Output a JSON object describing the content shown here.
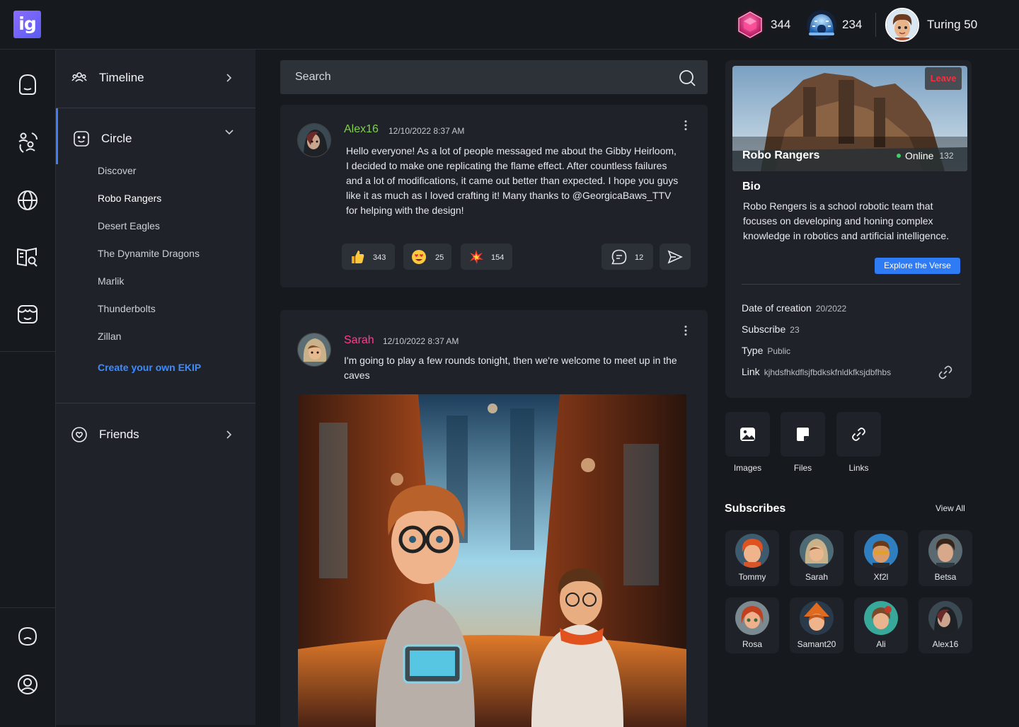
{
  "app": {
    "logo_text": "ig"
  },
  "topbar": {
    "stats": [
      {
        "icon": "pink-gem-icon",
        "value": "344"
      },
      {
        "icon": "blue-dome-icon",
        "value": "234"
      }
    ],
    "profile": {
      "name": "Turing 50",
      "avatar": "user-avatar"
    }
  },
  "rail": {
    "top_icons": [
      "home-icon",
      "people-icon",
      "globe-icon",
      "book-search-icon",
      "mask-icon"
    ],
    "bottom_icons": [
      "face-icon",
      "user-profile-icon"
    ]
  },
  "sidebar": {
    "timeline": {
      "label": "Timeline",
      "icon": "group-icon"
    },
    "circle": {
      "label": "Circle",
      "icon": "smiley-square-icon",
      "items": [
        "Discover",
        "Robo Rangers",
        "Desert Eagles",
        "The Dynamite Dragons",
        "Marlik",
        "Thunderbolts",
        "Zillan"
      ],
      "active_item": "Robo Rangers",
      "create_label": "Create your own EKIP"
    },
    "friends": {
      "label": "Friends",
      "icon": "heart-circle-icon"
    }
  },
  "search": {
    "placeholder": "Search"
  },
  "posts": [
    {
      "author": "Alex16",
      "author_color": "#7fd14a",
      "time": "12/10/2022 8:37 AM",
      "text": "Hello everyone! As a lot of people messaged me about the Gibby Heirloom, I decided to make one replicating the flame effect. After countless failures and a lot of modifications, it came out better than expected. I hope you guys like it as much as I loved crafting it! Many thanks to @GeorgicaBaws_TTV for helping with the design!",
      "reactions": [
        {
          "icon": "thumbs-up-emoji",
          "count": "343"
        },
        {
          "icon": "heart-eyes-emoji",
          "count": "25"
        },
        {
          "icon": "explosion-emoji",
          "count": "154"
        }
      ],
      "comments": "12"
    },
    {
      "author": "Sarah",
      "author_color": "#ff3d8e",
      "time": "12/10/2022 8:37 AM",
      "text": "I'm going to play a few rounds tonight, then we're welcome to meet up in the caves"
    }
  ],
  "group": {
    "name": "Robo Rangers",
    "online_label": "Online",
    "online_count": "132",
    "leave_label": "Leave",
    "bio_title": "Bio",
    "bio": "Robo Rengers is a school robotic team that focuses on developing and honing complex knowledge in robotics and artificial intelligence.",
    "explore_label": "Explore the Verse",
    "meta": [
      {
        "label": "Date of creation",
        "value": "20/2022"
      },
      {
        "label": "Subscribe",
        "value": "23"
      },
      {
        "label": "Type",
        "value": "Public"
      },
      {
        "label": "Link",
        "value": "kjhdsfhkdflsjfbdkskfnldkfksjdbfhbs"
      }
    ]
  },
  "media": [
    {
      "label": "Images",
      "icon": "image-icon"
    },
    {
      "label": "Files",
      "icon": "file-icon"
    },
    {
      "label": "Links",
      "icon": "link-icon"
    }
  ],
  "subscribes": {
    "title": "Subscribes",
    "view_all": "View All",
    "people": [
      "Tommy",
      "Sarah",
      "Xf2l",
      "Betsa",
      "Rosa",
      "Samant20",
      "Ali",
      "Alex16"
    ]
  },
  "colors": {
    "accent": "#3f7ef8",
    "background": "#16191e",
    "panel": "#1f2329"
  }
}
